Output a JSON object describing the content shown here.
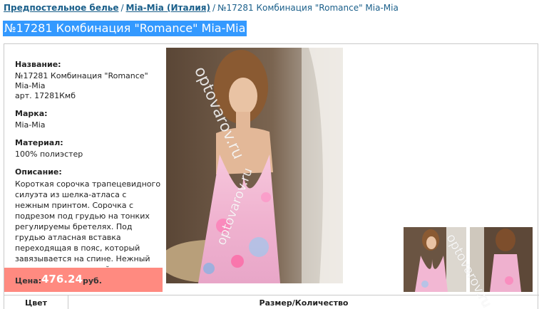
{
  "breadcrumb": {
    "items": [
      {
        "label": "Предпостельное белье"
      },
      {
        "label": "Mia-Mia (Италия)"
      }
    ],
    "separator": "/",
    "current": "№17281 Комбинация \"Romance\" Mia-Mia"
  },
  "title": "№17281 Комбинация \"Romance\" Mia-Mia",
  "product": {
    "name_label": "Название:",
    "name_line1": "№17281 Комбинация \"Romance\"",
    "name_line2": "Mia-Mia",
    "article": "арт. 17281Кмб",
    "brand_label": "Марка:",
    "brand": "Mia-Mia",
    "material_label": "Материал:",
    "material": "100% полиэстер",
    "description_label": "Описание:",
    "description": "Короткая сорочка трапецевидного силуэта из шелка-атласа с нежным принтом. Сорочка с подрезом под грудью на тонких регулируемы бретелях. Под грудью атласная вставка переходящая в пояс, который завязывается на спине. Нежный принт придает данной коллекции ве",
    "price_label": "Цена:",
    "price": "476.24",
    "currency": "руб."
  },
  "watermark": "optovarov.ru",
  "table": {
    "col_color": "Цвет",
    "col_size": "Размер/Количество"
  },
  "colors": {
    "title_bg": "#3399ff",
    "price_bg": "#ff8a80",
    "link": "#1a5f8a"
  }
}
